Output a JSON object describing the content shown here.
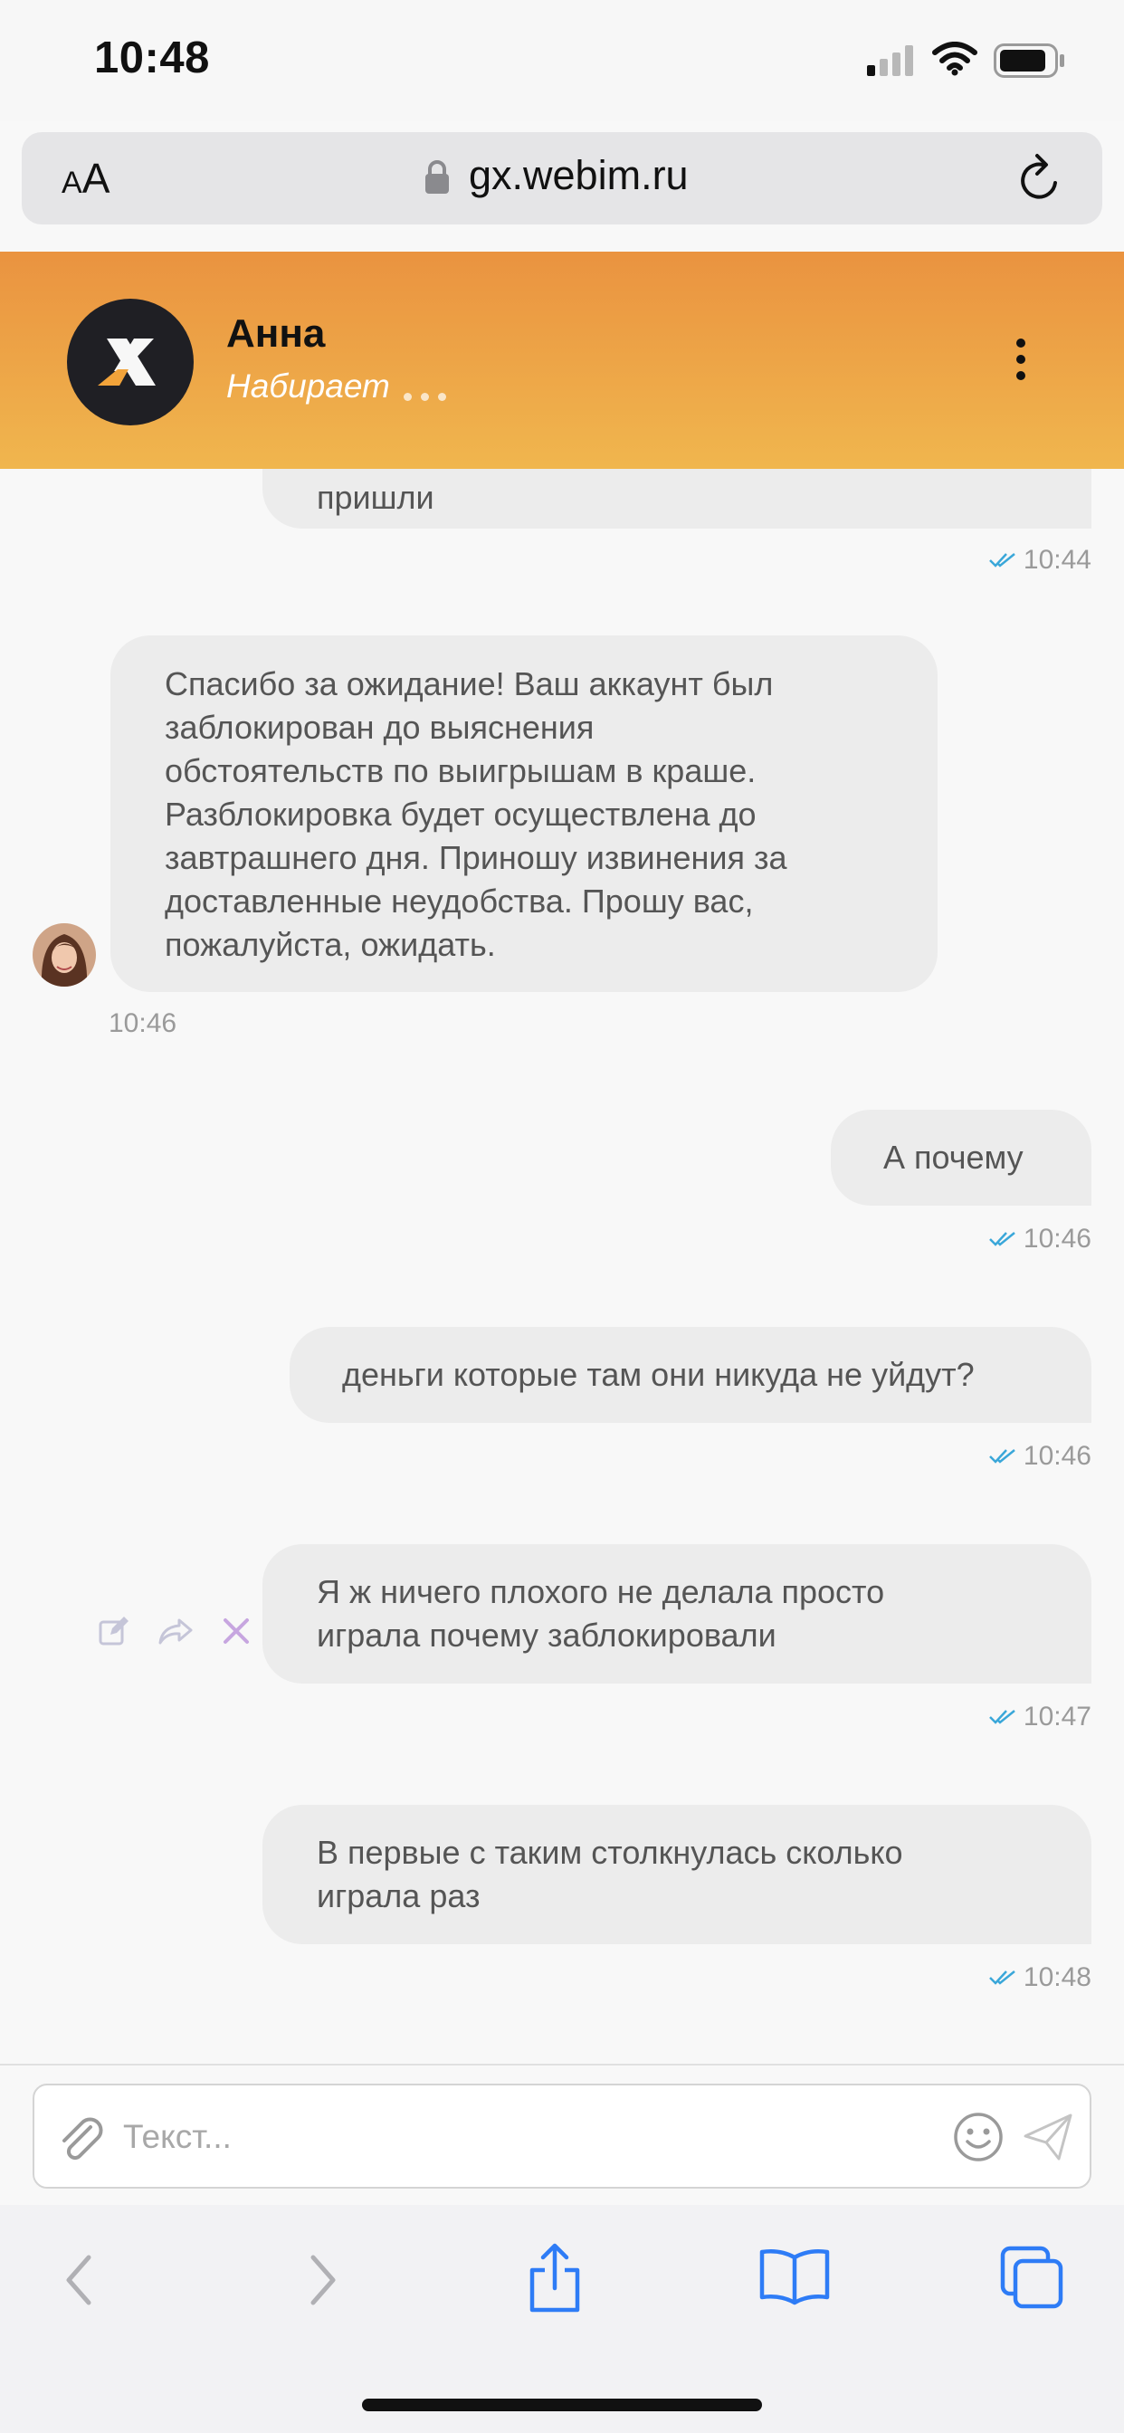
{
  "status_bar": {
    "time": "10:48"
  },
  "browser": {
    "text_size_small": "A",
    "text_size_large": "A",
    "url": "gx.webim.ru"
  },
  "chat_header": {
    "agent_name": "Анна",
    "agent_status": "Набирает",
    "accent_gradient": [
      "#ea9340",
      "#f0b64e"
    ]
  },
  "messages": [
    {
      "direction": "out",
      "text": "пришли",
      "time": "10:44",
      "read": true
    },
    {
      "direction": "in",
      "text": "Спасибо за ожидание! Ваш аккаунт был\nзаблокирован до выяснения\nобстоятельств по выигрышам в краше.\nРазблокировка будет осуществлена до\nзавтрашнего дня. Приношу извинения за\nдоставленные неудобства. Прошу вас,\nпожалуйста, ожидать.",
      "time": "10:46"
    },
    {
      "direction": "out",
      "text": "А почему",
      "time": "10:46",
      "read": true
    },
    {
      "direction": "out",
      "text": "деньги которые там они никуда не уйдут?",
      "time": "10:46",
      "read": true
    },
    {
      "direction": "out",
      "text": "Я ж ничего плохого не делала просто\nиграла почему заблокировали",
      "time": "10:47",
      "read": true
    },
    {
      "direction": "out",
      "text": "В первые с таким столкнулась сколько\nиграла раз",
      "time": "10:48",
      "read": true
    }
  ],
  "input": {
    "placeholder": "Текст...",
    "value": ""
  },
  "icons": {
    "status": [
      "signal-icon",
      "wifi-icon",
      "battery-icon"
    ],
    "header": [
      "webim-logo-icon",
      "more-vertical-icon"
    ],
    "message_actions": [
      "edit-icon",
      "reply-icon",
      "delete-icon"
    ],
    "input": [
      "paperclip-icon",
      "emoji-icon",
      "send-icon"
    ],
    "toolbar": [
      "back-icon",
      "forward-icon",
      "share-icon",
      "bookmarks-icon",
      "tabs-icon"
    ]
  }
}
